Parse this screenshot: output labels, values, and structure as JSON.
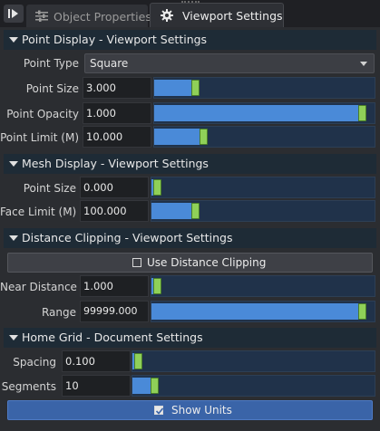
{
  "tabs": [
    {
      "label": "Object Properties",
      "icon": "sliders-icon",
      "active": false
    },
    {
      "label": "Viewport Settings",
      "icon": "gear-icon",
      "active": true
    }
  ],
  "point_display": {
    "title": "Point Display - Viewport Settings",
    "point_type": {
      "label": "Point Type",
      "value": "Square"
    },
    "point_size": {
      "label": "Point Size",
      "value": "3.000",
      "fraction": 0.17
    },
    "point_opacity": {
      "label": "Point Opacity",
      "value": "1.000",
      "fraction": 0.97
    },
    "point_limit": {
      "label": "Point Limit (M)",
      "value": "10.000",
      "fraction": 0.21
    }
  },
  "mesh_display": {
    "title": "Mesh Display - Viewport Settings",
    "point_size": {
      "label": "Point Size",
      "value": "0.000",
      "fraction": 0.0
    },
    "face_limit": {
      "label": "Face Limit (M)",
      "value": "100.000",
      "fraction": 0.18
    }
  },
  "distance_clipping": {
    "title": "Distance Clipping - Viewport Settings",
    "use_button": {
      "label": "Use Distance Clipping",
      "checked": false
    },
    "near_distance": {
      "label": "Near Distance",
      "value": "1.000",
      "fraction": 0.0
    },
    "range": {
      "label": "Range",
      "value": "99999.000",
      "fraction": 0.97
    }
  },
  "home_grid": {
    "title": "Home Grid - Document Settings",
    "spacing": {
      "label": "Spacing",
      "value": "0.100",
      "fraction": 0.0
    },
    "segments": {
      "label": "Segments",
      "value": "10",
      "fraction": 0.07
    },
    "show_units": {
      "label": "Show Units",
      "checked": true
    }
  },
  "colors": {
    "accent": "#4a8ad8",
    "thumb": "#8fd058",
    "header_bg": "#1e2b36",
    "button_blue": "#3a64a8"
  }
}
